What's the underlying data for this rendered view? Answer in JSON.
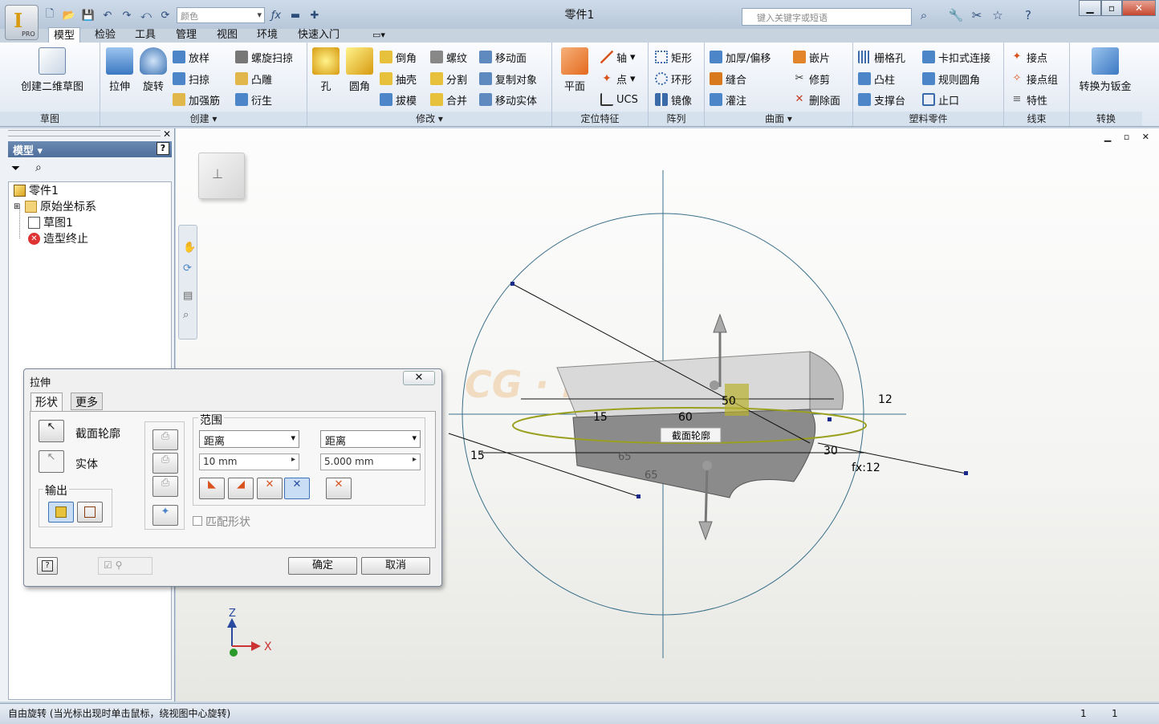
{
  "app": {
    "logo": "I",
    "logo_sub": "PRO",
    "window_title": "零件1",
    "color_placeholder": "颜色",
    "search_placeholder": "键入关键字或短语"
  },
  "tabs": [
    "模型",
    "检验",
    "工具",
    "管理",
    "视图",
    "环境",
    "快速入门"
  ],
  "ribbon": {
    "sketch": {
      "create_2d": "创建二维草图",
      "label": "草图"
    },
    "create": {
      "extrude": "拉伸",
      "revolve": "旋转",
      "loft": "放样",
      "sweep": "扫掠",
      "rib": "加强筋",
      "coil": "螺旋扫掠",
      "emboss": "凸雕",
      "derive": "衍生",
      "label": "创建"
    },
    "modify": {
      "hole": "孔",
      "fillet": "圆角",
      "chamfer": "倒角",
      "shell": "抽壳",
      "draft": "拔模",
      "thread": "螺纹",
      "split": "分割",
      "combine": "合并",
      "move_face": "移动面",
      "copy_object": "复制对象",
      "move_body": "移动实体",
      "label": "修改"
    },
    "work": {
      "plane": "平面",
      "axis": "轴",
      "point": "点",
      "ucs": "UCS",
      "label": "定位特征"
    },
    "pattern": {
      "rect": "矩形",
      "circ": "环形",
      "mirror": "镜像",
      "label": "阵列"
    },
    "surface": {
      "thicken": "加厚/偏移",
      "stitch": "缝合",
      "patch": "灌注",
      "sculpt": "嵌片",
      "trim": "修剪",
      "delete_face": "删除面",
      "label": "曲面"
    },
    "plastic": {
      "grill": "栅格孔",
      "boss": "凸柱",
      "rest": "支撑台",
      "snap": "卡扣式连接",
      "rule_fillet": "规则圆角",
      "lip": "止口",
      "label": "塑料零件"
    },
    "harness": {
      "point": "接点",
      "group": "接点组",
      "prop": "特性",
      "label": "线束"
    },
    "convert": {
      "sheet": "转换为钣金",
      "label": "转换"
    }
  },
  "browser": {
    "header": "模型",
    "tree": [
      "零件1",
      "原始坐标系",
      "草图1",
      "造型终止"
    ]
  },
  "dialog": {
    "title": "拉伸",
    "tab_shape": "形状",
    "tab_more": "更多",
    "profile": "截面轮廓",
    "solid": "实体",
    "output": "输出",
    "extents": "范围",
    "dist1": "距离",
    "dist2": "距离",
    "val1": "10 mm",
    "val2": "5.000 mm",
    "match": "匹配形状",
    "ok": "确定",
    "cancel": "取消"
  },
  "viewport": {
    "dims": [
      "15",
      "60",
      "12",
      "15",
      "50",
      "30",
      "fx:12",
      "65",
      "65"
    ],
    "profile_tooltip": "截面轮廓",
    "axis_x": "X",
    "axis_z": "Z",
    "watermark": "CG  ·  r2011"
  },
  "status": {
    "text": "自由旋转 (当光标出现时单击鼠标，绕视图中心旋转)",
    "n1": "1",
    "n2": "1"
  }
}
